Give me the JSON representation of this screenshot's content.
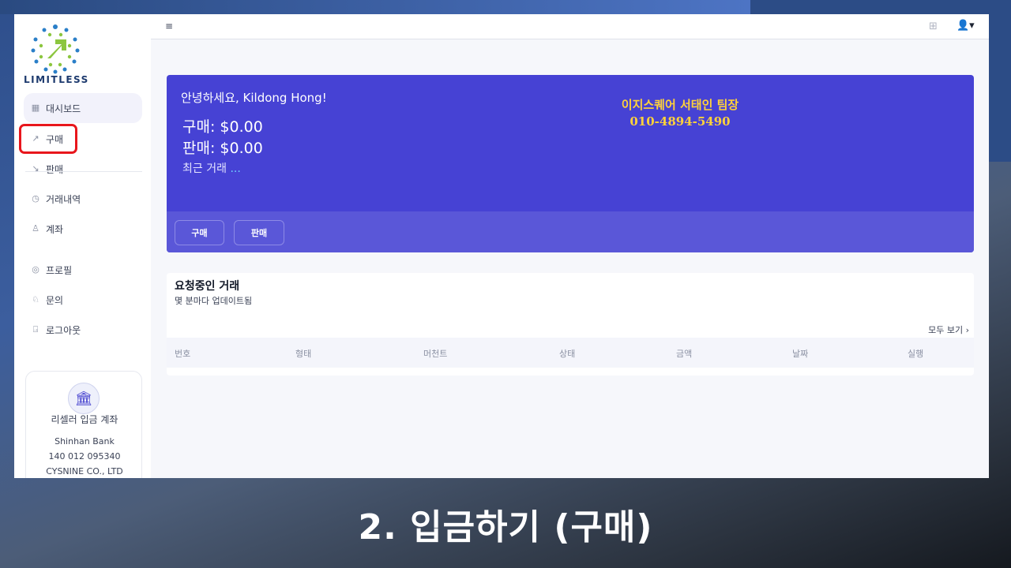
{
  "brand": {
    "name": "LIMITLESS"
  },
  "sidebar": {
    "items": [
      {
        "label": "대시보드",
        "icon": "dashboard-icon"
      },
      {
        "label": "구매",
        "icon": "buy-icon"
      },
      {
        "label": "판매",
        "icon": "sell-icon"
      },
      {
        "label": "거래내역",
        "icon": "history-icon"
      },
      {
        "label": "계좌",
        "icon": "account-icon"
      },
      {
        "label": "프로필",
        "icon": "profile-icon"
      },
      {
        "label": "문의",
        "icon": "inquiry-icon"
      },
      {
        "label": "로그아웃",
        "icon": "logout-icon"
      }
    ],
    "bank": {
      "title": "리셀러 입금 계좌",
      "bank_name": "Shinhan Bank",
      "account_number": "140 012 095340",
      "holder": "CYSNINE CO., LTD"
    }
  },
  "hero": {
    "greeting": "안녕하세요, Kildong Hong!",
    "buy_total": "구매: $0.00",
    "sell_total": "판매: $0.00",
    "recent_label": "최근 거래",
    "recent_dots": "...",
    "note_line1": "이지스퀘어 서태인 팀장",
    "note_line2": "010-4894-5490",
    "buy_button": "구매",
    "sell_button": "판매"
  },
  "requests": {
    "title": "요청중인 거래",
    "subtitle": "몇 분마다 업데이트됨",
    "see_all": "모두 보기",
    "columns": [
      "번호",
      "형태",
      "머천트",
      "상태",
      "금액",
      "날짜",
      "실행"
    ]
  },
  "caption": "2. 입금하기 (구매)",
  "colors": {
    "primary": "#4642d4",
    "highlight": "#e8161c",
    "note": "#ffd23a"
  }
}
